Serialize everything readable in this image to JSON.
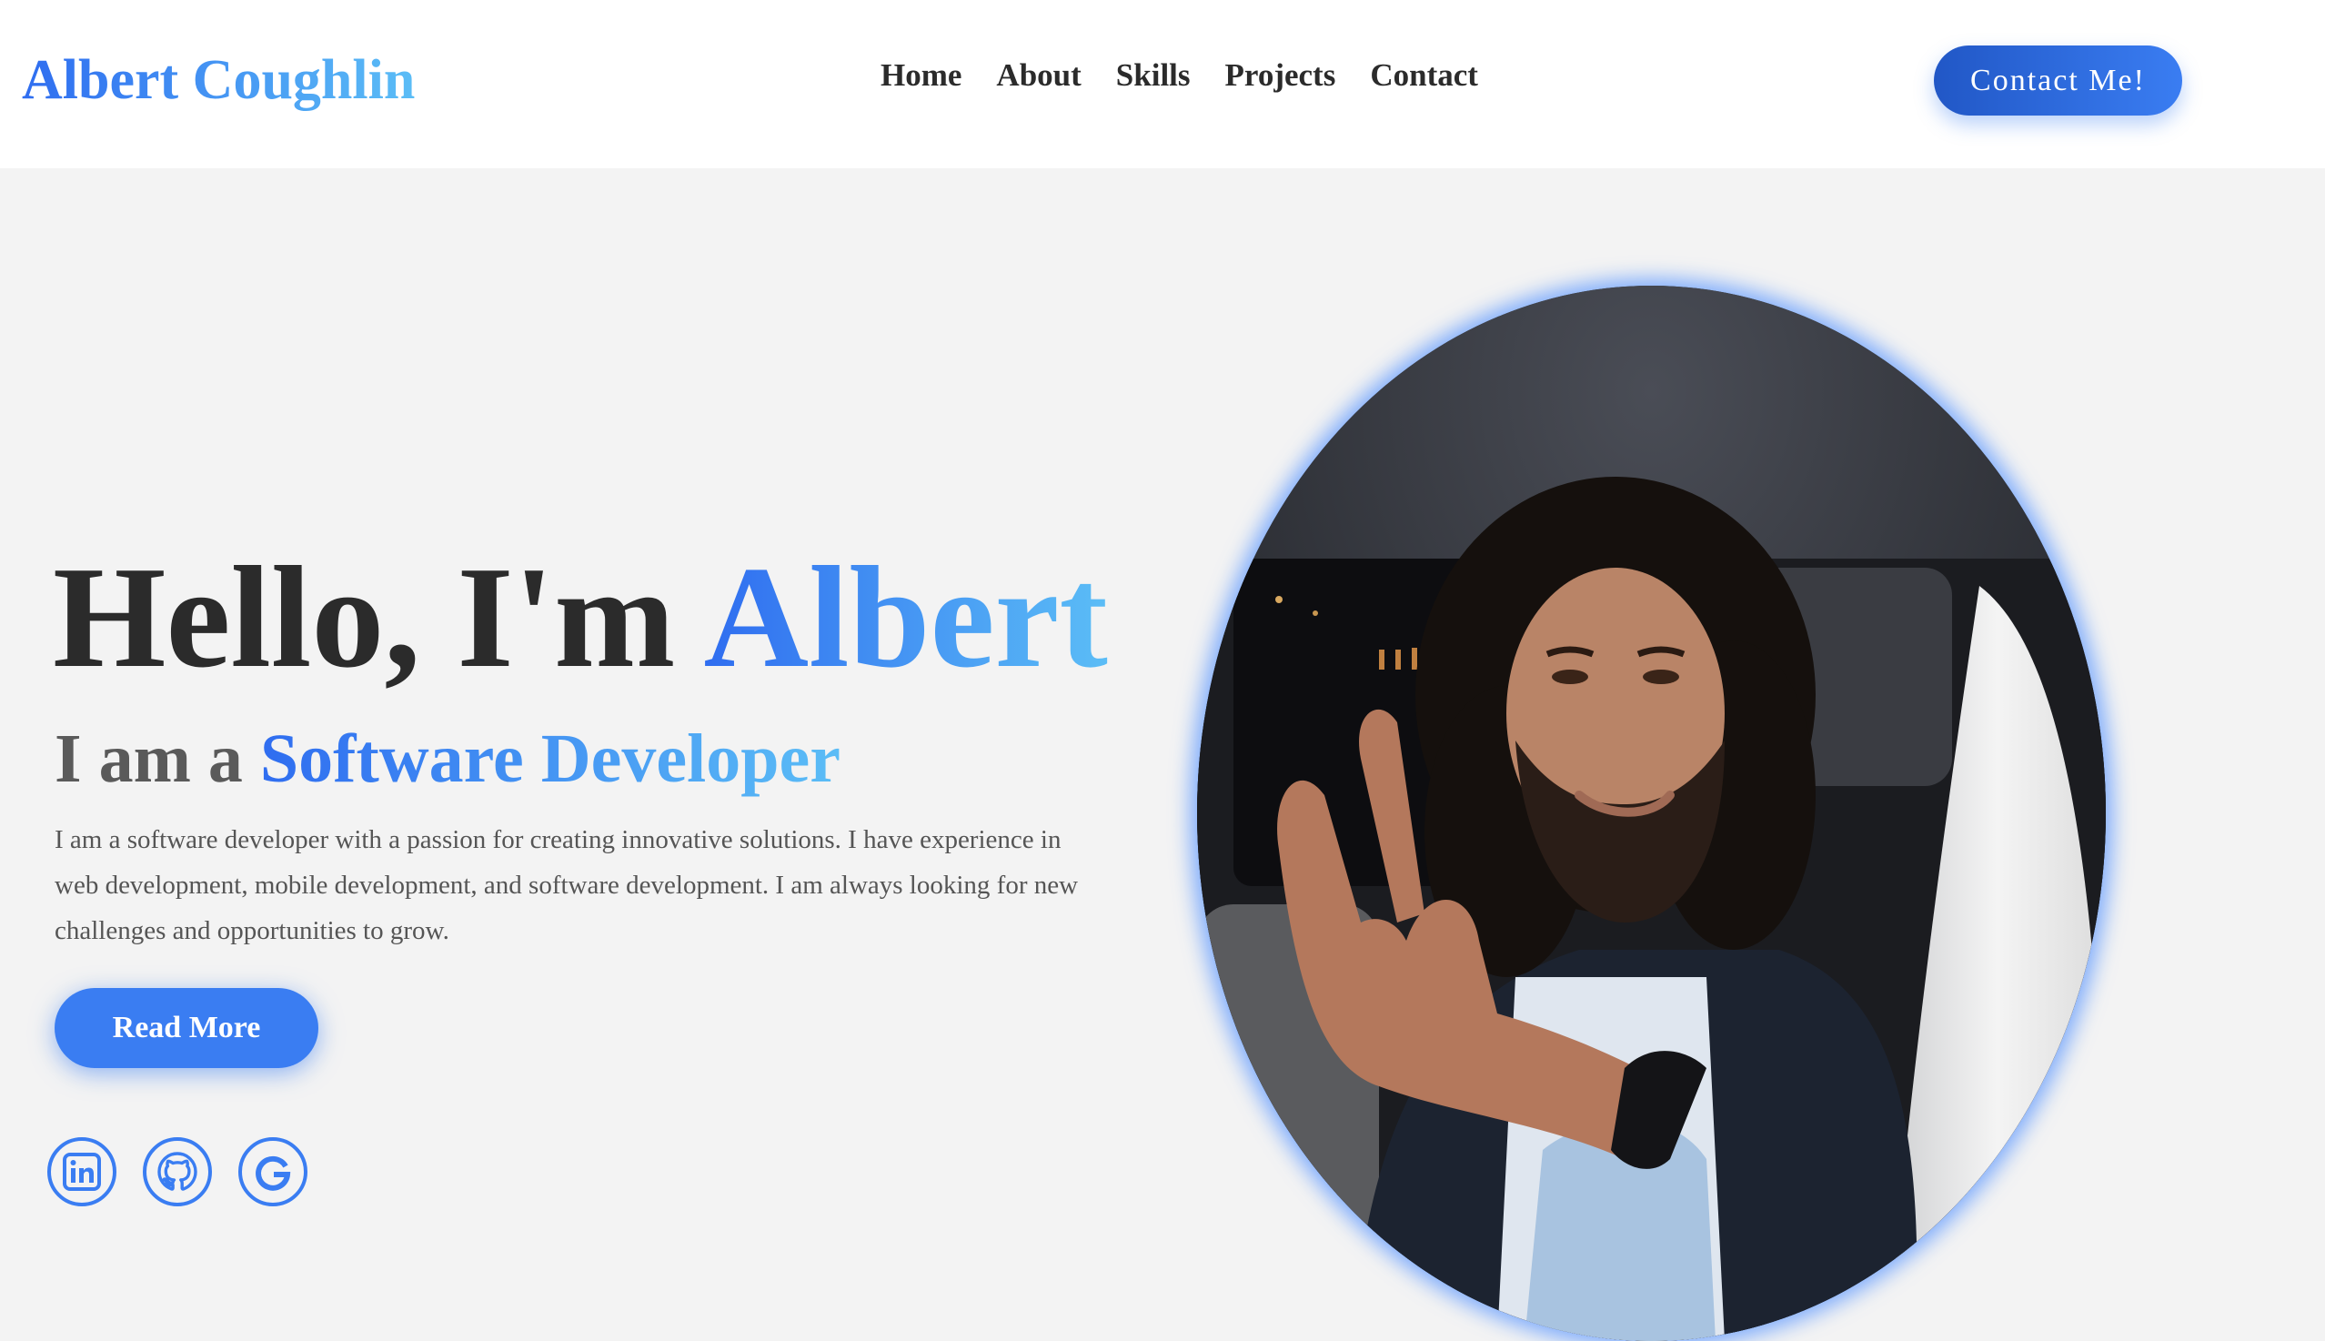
{
  "header": {
    "logo": "Albert Coughlin",
    "nav": [
      "Home",
      "About",
      "Skills",
      "Projects",
      "Contact"
    ],
    "contact_button": "Contact Me!"
  },
  "hero": {
    "greeting": "Hello, I'm ",
    "name": "Albert",
    "role_prefix": "I am a ",
    "role": "Software Developer",
    "description": "I am a software developer with a passion for creating innovative solutions. I have experience in web development, mobile development, and software development. I am always looking for new challenges and opportunities to grow.",
    "read_more": "Read More"
  },
  "socials": [
    {
      "icon": "linkedin-icon"
    },
    {
      "icon": "github-icon"
    },
    {
      "icon": "google-icon"
    }
  ],
  "colors": {
    "accent": "#3a7df2",
    "gradient_start": "#2f6df0",
    "gradient_end": "#5bbdf6",
    "text_dark": "#2b2b2b",
    "background": "#f3f3f3"
  }
}
